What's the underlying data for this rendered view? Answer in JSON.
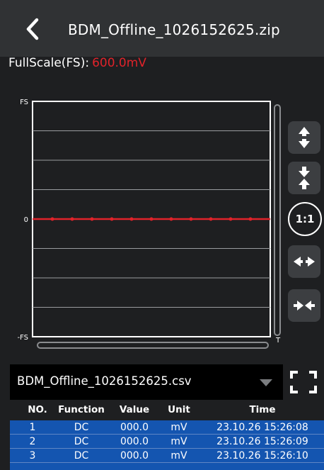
{
  "header": {
    "title": "BDM_Offline_1026152625.zip",
    "back_icon": "chevron-left-icon"
  },
  "fullscale": {
    "label": "FullScale(FS):",
    "value": "600.0mV",
    "value_color": "#e0232a"
  },
  "chart_data": {
    "type": "line",
    "y_tick_labels": [
      "FS",
      "0",
      "-FS"
    ],
    "x_end_label": "T",
    "ylim": [
      -600,
      600
    ],
    "xlim": [
      0,
      12
    ],
    "grid": true,
    "grid_rows": 8,
    "series": [
      {
        "color": "#e0232a",
        "x": [
          0,
          1,
          2,
          3,
          4,
          5,
          6,
          7,
          8,
          9,
          10,
          11,
          12
        ],
        "values": [
          0,
          0,
          0,
          0,
          0,
          0,
          0,
          0,
          0,
          0,
          0,
          0,
          0
        ]
      }
    ]
  },
  "side_controls": {
    "expand_vertical": "arrows-vertical-expand-icon",
    "compress_vertical": "arrows-vertical-compress-icon",
    "ratio_label": "1:1",
    "expand_horizontal": "arrows-horizontal-expand-icon",
    "compress_horizontal": "arrows-horizontal-compress-icon"
  },
  "file_select": {
    "value": "BDM_Offline_1026152625.csv",
    "caret_icon": "triangle-down-icon",
    "fullscreen_icon": "fullscreen-icon"
  },
  "table": {
    "headers": [
      "NO.",
      "Function",
      "Value",
      "Unit",
      "Time"
    ],
    "rows": [
      [
        "1",
        "DC",
        "000.0",
        "mV",
        "23.10.26 15:26:08"
      ],
      [
        "2",
        "DC",
        "000.0",
        "mV",
        "23.10.26 15:26:09"
      ],
      [
        "3",
        "DC",
        "000.0",
        "mV",
        "23.10.26 15:26:10"
      ]
    ]
  }
}
